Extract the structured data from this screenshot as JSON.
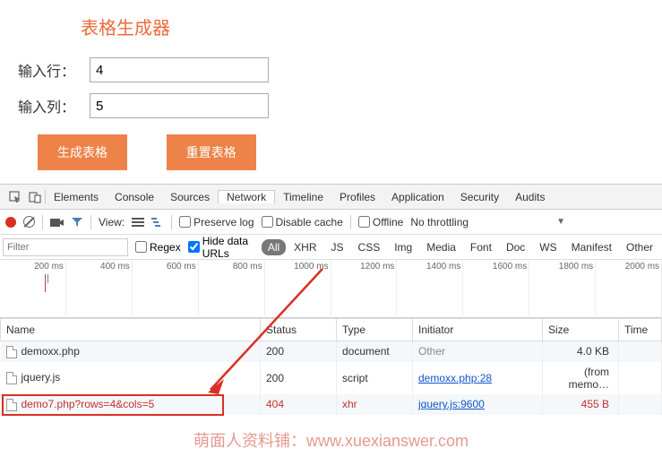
{
  "app": {
    "title": "表格生成器",
    "rows_label": "输入行：",
    "cols_label": "输入列：",
    "rows_value": "4",
    "cols_value": "5",
    "generate_btn": "生成表格",
    "reset_btn": "重置表格"
  },
  "devtools": {
    "tabs": [
      "Elements",
      "Console",
      "Sources",
      "Network",
      "Timeline",
      "Profiles",
      "Application",
      "Security",
      "Audits"
    ],
    "active_tab": "Network",
    "toolbar": {
      "view_label": "View:",
      "preserve_log": "Preserve log",
      "disable_cache": "Disable cache",
      "offline": "Offline",
      "throttling": "No throttling"
    },
    "filter": {
      "placeholder": "Filter",
      "regex": "Regex",
      "hide_data": "Hide data URLs",
      "types": [
        "All",
        "XHR",
        "JS",
        "CSS",
        "Img",
        "Media",
        "Font",
        "Doc",
        "WS",
        "Manifest",
        "Other"
      ],
      "active_type": "All"
    },
    "timeline_ticks": [
      "200 ms",
      "400 ms",
      "600 ms",
      "800 ms",
      "1000 ms",
      "1200 ms",
      "1400 ms",
      "1600 ms",
      "1800 ms",
      "2000 ms"
    ],
    "table": {
      "headers": {
        "name": "Name",
        "status": "Status",
        "type": "Type",
        "initiator": "Initiator",
        "size": "Size",
        "time": "Time"
      },
      "rows": [
        {
          "name": "demoxx.php",
          "status": "200",
          "type": "document",
          "initiator": "Other",
          "initiator_link": false,
          "size": "4.0 KB",
          "err": false
        },
        {
          "name": "jquery.js",
          "status": "200",
          "type": "script",
          "initiator": "demoxx.php:28",
          "initiator_link": true,
          "size": "(from memo…",
          "err": false
        },
        {
          "name": "demo7.php?rows=4&cols=5",
          "status": "404",
          "type": "xhr",
          "initiator": "jquery.js:9600",
          "initiator_link": true,
          "size": "455 B",
          "err": true
        }
      ]
    }
  },
  "watermark": "萌面人资料铺：www.xuexianswer.com"
}
